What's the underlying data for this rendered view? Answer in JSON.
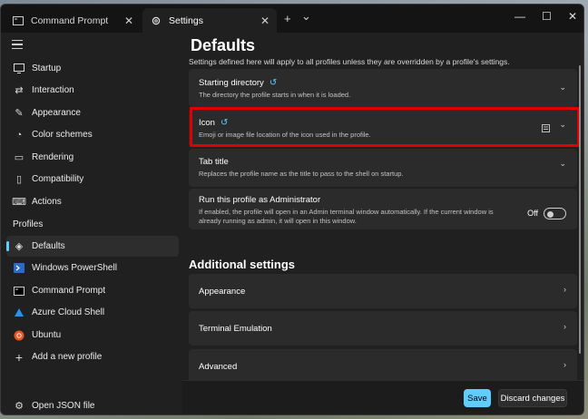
{
  "tabs": [
    {
      "label": "Command Prompt",
      "active": false
    },
    {
      "label": "Settings",
      "active": true
    }
  ],
  "titlebar": {
    "new_tab": "+",
    "dropdown": "⌄",
    "minimize": "—",
    "maximize": "☐",
    "close": "✕"
  },
  "sidebar": {
    "items": [
      {
        "label": "Startup",
        "icon": "startup-icon"
      },
      {
        "label": "Interaction",
        "icon": "interaction-icon"
      },
      {
        "label": "Appearance",
        "icon": "appearance-icon"
      },
      {
        "label": "Color schemes",
        "icon": "color-schemes-icon"
      },
      {
        "label": "Rendering",
        "icon": "rendering-icon"
      },
      {
        "label": "Compatibility",
        "icon": "compatibility-icon"
      },
      {
        "label": "Actions",
        "icon": "actions-icon"
      }
    ],
    "profiles_header": "Profiles",
    "profiles": [
      {
        "label": "Defaults",
        "icon": "layers-icon",
        "selected": true
      },
      {
        "label": "Windows PowerShell",
        "icon": "powershell-icon"
      },
      {
        "label": "Command Prompt",
        "icon": "cmd-icon"
      },
      {
        "label": "Azure Cloud Shell",
        "icon": "azure-icon"
      },
      {
        "label": "Ubuntu",
        "icon": "ubuntu-icon"
      },
      {
        "label": "Add a new profile",
        "icon": "plus-icon"
      }
    ],
    "open_json": "Open JSON file"
  },
  "main": {
    "title": "Defaults",
    "subtitle": "Settings defined here will apply to all profiles unless they are overridden by a profile's settings.",
    "cards": [
      {
        "title": "Starting directory",
        "desc": "The directory the profile starts in when it is loaded."
      },
      {
        "title": "Icon",
        "desc": "Emoji or image file location of the icon used in the profile."
      },
      {
        "title": "Tab title",
        "desc": "Replaces the profile name as the title to pass to the shell on startup."
      },
      {
        "title": "Run this profile as Administrator",
        "desc_line1": "If enabled, the profile will open in an Admin terminal window automatically. If the current window is",
        "desc_line2": "already running as admin, it will open in this window.",
        "toggle": "Off"
      }
    ],
    "additional_title": "Additional settings",
    "additional": [
      "Appearance",
      "Terminal Emulation",
      "Advanced"
    ]
  },
  "footer": {
    "save": "Save",
    "discard": "Discard changes"
  },
  "colors": {
    "accent": "#60cdff",
    "highlight": "#e00000"
  }
}
